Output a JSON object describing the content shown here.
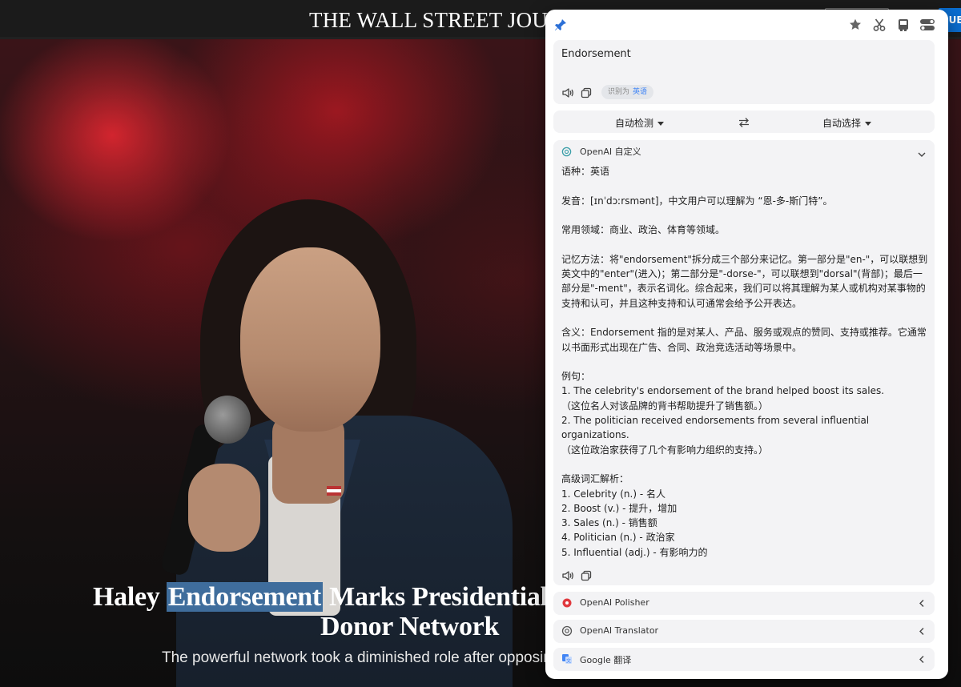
{
  "site": {
    "masthead": "THE WALL STREET JOURNAL.",
    "subscribe_label": "SUBSCRIBE"
  },
  "article": {
    "headline_pre": "Haley ",
    "headline_highlight": "Endorsement",
    "headline_post": " Marks Presidential",
    "headline_line2": "Donor Network",
    "dek": "The powerful network took a diminished role after opposing"
  },
  "translator": {
    "input_text": "Endorsement",
    "detected_prefix": "识别为",
    "detected_lang": "英语",
    "source_lang": "自动检测",
    "target_lang": "自动选择",
    "result_service": "OpenAI 自定义",
    "result_lines": [
      "语种：英语",
      "",
      "发音：[ɪnˈdɔːrsmənt]，中文用户可以理解为 “恩-多-斯门特”。",
      "",
      "常用领域：商业、政治、体育等领域。",
      "",
      "记忆方法：将\"endorsement\"拆分成三个部分来记忆。第一部分是\"en-\"，可以联想到英文中的\"enter\"(进入)；第二部分是\"-dorse-\"，可以联想到\"dorsal\"(背部)；最后一部分是\"-ment\"，表示名词化。综合起来，我们可以将其理解为某人或机构对某事物的支持和认可，并且这种支持和认可通常会给予公开表达。",
      "",
      "含义：Endorsement 指的是对某人、产品、服务或观点的赞同、支持或推荐。它通常以书面形式出现在广告、合同、政治竞选活动等场景中。",
      "",
      "例句：",
      "1. The celebrity's endorsement of the brand helped boost its sales.",
      "（这位名人对该品牌的背书帮助提升了销售额。）",
      "2. The politician received endorsements from several influential organizations.",
      "（这位政治家获得了几个有影响力组织的支持。）",
      "",
      "高级词汇解析：",
      "1. Celebrity (n.) - 名人",
      "2. Boost (v.) - 提升，增加",
      "3. Sales (n.) - 销售额",
      "4. Politician (n.) - 政治家",
      "5. Influential (adj.) - 有影响力的"
    ],
    "services": [
      {
        "label": "OpenAI Polisher",
        "icon": "polisher-icon",
        "color": "#e0393e"
      },
      {
        "label": "OpenAI Translator",
        "icon": "openai-icon",
        "color": "#555555"
      },
      {
        "label": "Google 翻译",
        "icon": "google-translate-icon",
        "color": "#4285f4"
      }
    ],
    "accent_color": "#3b82f6"
  }
}
